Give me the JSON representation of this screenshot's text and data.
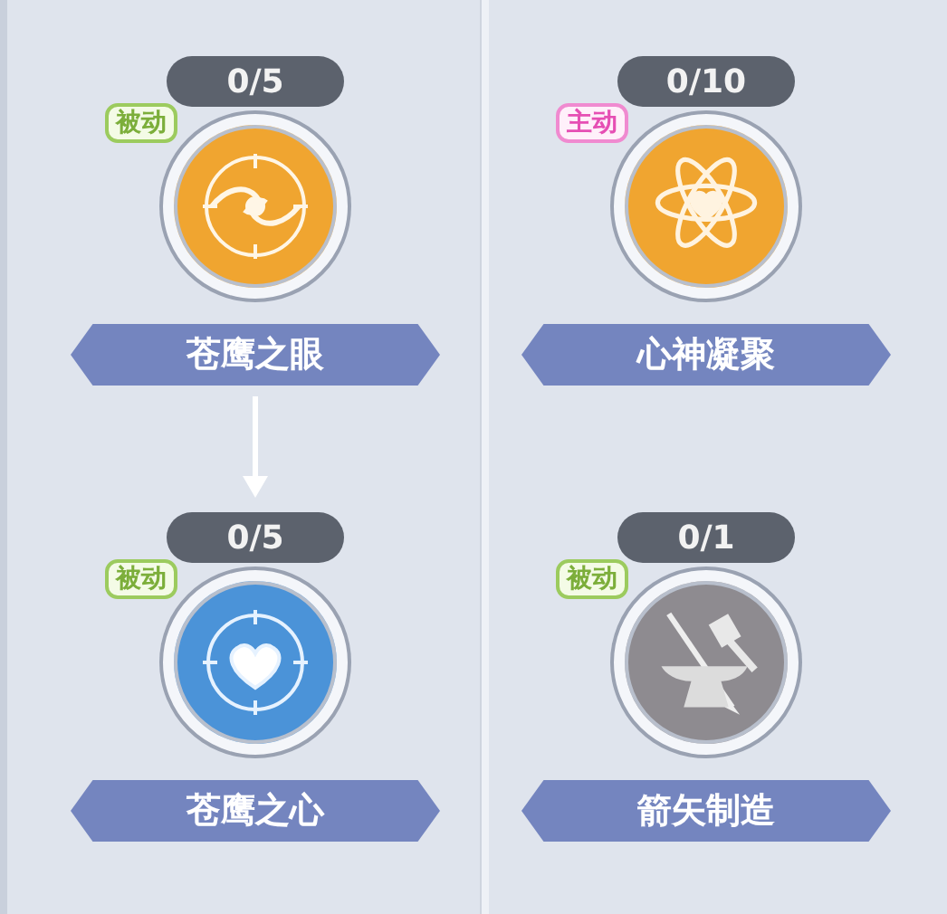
{
  "columns": [
    {
      "skills": [
        {
          "level": "0/5",
          "tag": {
            "label": "被动",
            "kind": "passive"
          },
          "color": "#f0a530",
          "name": "苍鹰之眼",
          "arrow_below": true
        },
        {
          "level": "0/5",
          "tag": {
            "label": "被动",
            "kind": "passive"
          },
          "color": "#4b93d8",
          "name": "苍鹰之心",
          "arrow_below": false
        }
      ]
    },
    {
      "skills": [
        {
          "level": "0/10",
          "tag": {
            "label": "主动",
            "kind": "active"
          },
          "color": "#f0a530",
          "name": "心神凝聚",
          "arrow_below": false
        },
        {
          "level": "0/1",
          "tag": {
            "label": "被动",
            "kind": "passive"
          },
          "color": "#8e8b90",
          "name": "箭矢制造",
          "arrow_below": false
        }
      ]
    }
  ]
}
